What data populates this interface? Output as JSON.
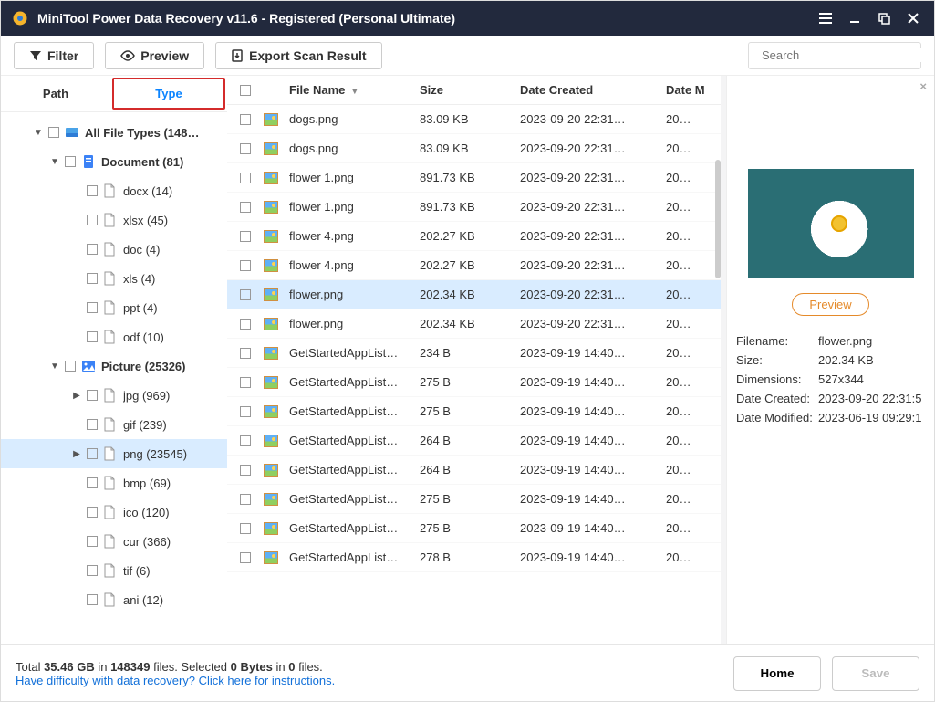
{
  "titlebar": {
    "title": "MiniTool Power Data Recovery v11.6 - Registered (Personal Ultimate)"
  },
  "toolbar": {
    "filter": "Filter",
    "preview": "Preview",
    "export": "Export Scan Result",
    "search_placeholder": "Search"
  },
  "tabs": {
    "path": "Path",
    "type": "Type"
  },
  "tree": [
    {
      "depth": 0,
      "exp": "down",
      "bold": true,
      "icon": "drive",
      "label": "All File Types (148…"
    },
    {
      "depth": 1,
      "exp": "down",
      "bold": true,
      "icon": "doc-blue",
      "label": "Document (81)"
    },
    {
      "depth": 2,
      "icon": "file",
      "label": "docx (14)"
    },
    {
      "depth": 2,
      "icon": "file",
      "label": "xlsx (45)"
    },
    {
      "depth": 2,
      "icon": "file",
      "label": "doc (4)"
    },
    {
      "depth": 2,
      "icon": "file",
      "label": "xls (4)"
    },
    {
      "depth": 2,
      "icon": "file",
      "label": "ppt (4)"
    },
    {
      "depth": 2,
      "icon": "file",
      "label": "odf (10)"
    },
    {
      "depth": 1,
      "exp": "down",
      "bold": true,
      "icon": "pic",
      "label": "Picture (25326)"
    },
    {
      "depth": 3,
      "exp": "right",
      "icon": "file",
      "label": "jpg (969)"
    },
    {
      "depth": 2,
      "icon": "file",
      "label": "gif (239)"
    },
    {
      "depth": 3,
      "exp": "right",
      "icon": "file",
      "label": "png (23545)",
      "sel": true
    },
    {
      "depth": 2,
      "icon": "file",
      "label": "bmp (69)"
    },
    {
      "depth": 2,
      "icon": "file",
      "label": "ico (120)"
    },
    {
      "depth": 2,
      "icon": "file",
      "label": "cur (366)"
    },
    {
      "depth": 2,
      "icon": "file",
      "label": "tif (6)"
    },
    {
      "depth": 2,
      "icon": "file",
      "label": "ani (12)"
    }
  ],
  "columns": {
    "name": "File Name",
    "size": "Size",
    "dc": "Date Created",
    "dm": "Date M"
  },
  "files": [
    {
      "name": "dogs.png",
      "size": "83.09 KB",
      "dc": "2023-09-20 22:31…",
      "dm": "20…"
    },
    {
      "name": "dogs.png",
      "size": "83.09 KB",
      "dc": "2023-09-20 22:31…",
      "dm": "20…"
    },
    {
      "name": "flower 1.png",
      "size": "891.73 KB",
      "dc": "2023-09-20 22:31…",
      "dm": "20…"
    },
    {
      "name": "flower 1.png",
      "size": "891.73 KB",
      "dc": "2023-09-20 22:31…",
      "dm": "20…"
    },
    {
      "name": "flower 4.png",
      "size": "202.27 KB",
      "dc": "2023-09-20 22:31…",
      "dm": "20…"
    },
    {
      "name": "flower 4.png",
      "size": "202.27 KB",
      "dc": "2023-09-20 22:31…",
      "dm": "20…"
    },
    {
      "name": "flower.png",
      "size": "202.34 KB",
      "dc": "2023-09-20 22:31…",
      "dm": "20…",
      "sel": true
    },
    {
      "name": "flower.png",
      "size": "202.34 KB",
      "dc": "2023-09-20 22:31…",
      "dm": "20…"
    },
    {
      "name": "GetStartedAppList…",
      "size": "234 B",
      "dc": "2023-09-19 14:40…",
      "dm": "20…"
    },
    {
      "name": "GetStartedAppList…",
      "size": "275 B",
      "dc": "2023-09-19 14:40…",
      "dm": "20…"
    },
    {
      "name": "GetStartedAppList…",
      "size": "275 B",
      "dc": "2023-09-19 14:40…",
      "dm": "20…"
    },
    {
      "name": "GetStartedAppList…",
      "size": "264 B",
      "dc": "2023-09-19 14:40…",
      "dm": "20…"
    },
    {
      "name": "GetStartedAppList…",
      "size": "264 B",
      "dc": "2023-09-19 14:40…",
      "dm": "20…"
    },
    {
      "name": "GetStartedAppList…",
      "size": "275 B",
      "dc": "2023-09-19 14:40…",
      "dm": "20…"
    },
    {
      "name": "GetStartedAppList…",
      "size": "275 B",
      "dc": "2023-09-19 14:40…",
      "dm": "20…"
    },
    {
      "name": "GetStartedAppList…",
      "size": "278 B",
      "dc": "2023-09-19 14:40…",
      "dm": "20…"
    }
  ],
  "preview": {
    "button": "Preview",
    "meta": {
      "filename_k": "Filename:",
      "filename_v": "flower.png",
      "size_k": "Size:",
      "size_v": "202.34 KB",
      "dim_k": "Dimensions:",
      "dim_v": "527x344",
      "dc_k": "Date Created:",
      "dc_v": "2023-09-20 22:31:5",
      "dm_k": "Date Modified:",
      "dm_v": "2023-06-19 09:29:1"
    }
  },
  "footer": {
    "total_pre": "Total ",
    "total_size": "35.46 GB",
    "in1": " in ",
    "total_files": "148349",
    "files_txt": " files.  Selected ",
    "sel_size": "0 Bytes",
    "in2": " in ",
    "sel_files": "0",
    "files_txt2": " files.",
    "help": "Have difficulty with data recovery? Click here for instructions.",
    "home": "Home",
    "save": "Save"
  }
}
